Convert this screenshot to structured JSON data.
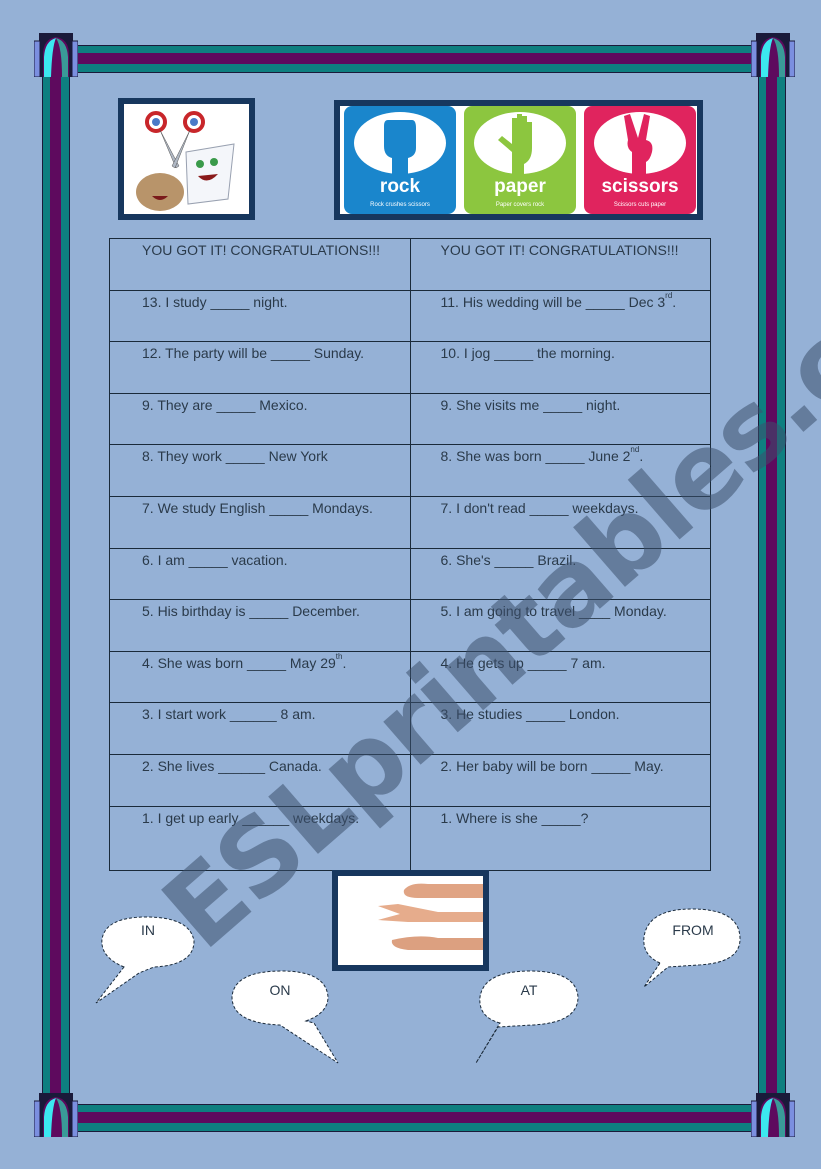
{
  "colors": {
    "background": "#95b1d6",
    "border_teal": "#0e7f80",
    "border_purple": "#5e0a5e",
    "frame_navy": "#17375e",
    "rock_blue": "#1a86cc",
    "paper_green": "#8cc63f",
    "scissors_red": "#e0245e"
  },
  "header_images": {
    "characters_image": "rock-paper-scissors-cartoon-characters",
    "banner": {
      "tiles": [
        {
          "word": "rock",
          "caption": "Rock crushes scissors",
          "icon": "fist-icon"
        },
        {
          "word": "paper",
          "caption": "Paper covers rock",
          "icon": "open-hand-icon"
        },
        {
          "word": "scissors",
          "caption": "Scissors cuts paper",
          "icon": "two-fingers-icon"
        }
      ]
    }
  },
  "table": {
    "header": [
      "YOU GOT IT! CONGRATULATIONS!!!",
      "YOU GOT IT! CONGRATULATIONS!!!"
    ],
    "rows": [
      [
        {
          "text": "13.  I study _____ night.",
          "sup": "",
          "after": ""
        },
        {
          "text": "11. His wedding will be _____ Dec 3",
          "sup": "rd",
          "after": "."
        }
      ],
      [
        {
          "text": "12. The party will be _____ Sunday.",
          "sup": "",
          "after": ""
        },
        {
          "text": "10. I jog _____ the morning.",
          "sup": "",
          "after": ""
        }
      ],
      [
        {
          "text": "9. They are _____ Mexico.",
          "sup": "",
          "after": ""
        },
        {
          "text": "9.  She visits me _____ night.",
          "sup": "",
          "after": ""
        }
      ],
      [
        {
          "text": "8.  They work _____ New York",
          "sup": "",
          "after": ""
        },
        {
          "text": "8.   She was born _____ June 2",
          "sup": "nd",
          "after": "."
        }
      ],
      [
        {
          "text": "7.   We study English _____ Mondays.",
          "sup": "",
          "after": ""
        },
        {
          "text": "7.   I don't read _____ weekdays.",
          "sup": "",
          "after": ""
        }
      ],
      [
        {
          "text": "6.    I am _____ vacation.",
          "sup": "",
          "after": ""
        },
        {
          "text": "6.   She's _____ Brazil.",
          "sup": "",
          "after": ""
        }
      ],
      [
        {
          "text": "5.   His birthday is _____ December.",
          "sup": "",
          "after": ""
        },
        {
          "text": "5.   I am going to travel ____ Monday.",
          "sup": "",
          "after": ""
        }
      ],
      [
        {
          "text": "4.    She was born _____ May 29",
          "sup": "th",
          "after": "."
        },
        {
          "text": "4.   He gets up _____ 7 am.",
          "sup": "",
          "after": ""
        }
      ],
      [
        {
          "text": "3.    I start work ______ 8 am.",
          "sup": "",
          "after": ""
        },
        {
          "text": "3.   He studies _____ London.",
          "sup": "",
          "after": ""
        }
      ],
      [
        {
          "text": "2.   She lives ______ Canada.",
          "sup": "",
          "after": ""
        },
        {
          "text": "2.   Her baby will be born _____ May.",
          "sup": "",
          "after": ""
        }
      ],
      [
        {
          "text": "1.   I get up early ______ weekdays.",
          "sup": "",
          "after": ""
        },
        {
          "text": "1.   Where is she _____?",
          "sup": "",
          "after": ""
        }
      ]
    ]
  },
  "hands_image": "hands-rock-scissors-paper-photo",
  "bubbles": [
    "IN",
    "ON",
    "AT",
    "FROM"
  ],
  "watermark": "ESLprintables.com"
}
